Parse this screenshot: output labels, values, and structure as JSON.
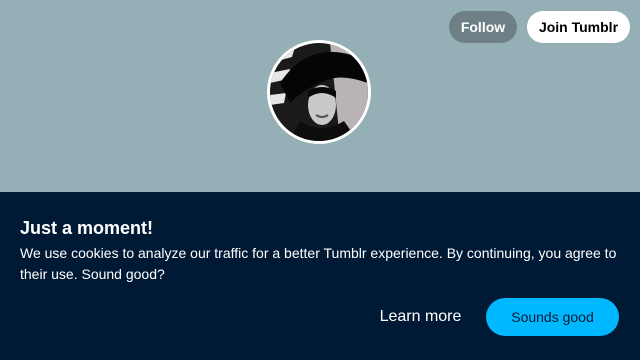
{
  "header": {
    "follow_label": "Follow",
    "join_label": "Join Tumblr",
    "background_color": "#94b0b6"
  },
  "avatar": {
    "icon": "blog-avatar-image"
  },
  "cookie_banner": {
    "title": "Just a moment!",
    "message": "We use cookies to analyze our traffic for a better Tumblr experience. By continuing, you agree to their use. Sound good?",
    "learn_more_label": "Learn more",
    "accept_label": "Sounds good",
    "background_color": "#001935",
    "accent_color": "#00b8ff"
  }
}
